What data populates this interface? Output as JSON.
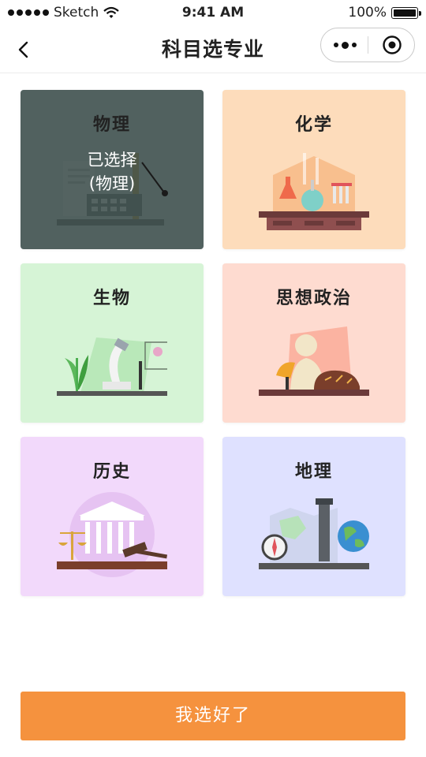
{
  "status_bar": {
    "carrier": "Sketch",
    "time": "9:41 AM",
    "battery": "100%"
  },
  "nav": {
    "title": "科目选专业"
  },
  "subjects": [
    {
      "label": "物理",
      "selected": true,
      "selected_text": "已选择",
      "selected_sub": "(物理)",
      "color": "#dfe7e6"
    },
    {
      "label": "化学",
      "selected": false,
      "color": "#fddcbb"
    },
    {
      "label": "生物",
      "selected": false,
      "color": "#d6f4d6"
    },
    {
      "label": "思想政治",
      "selected": false,
      "color": "#fedbd0"
    },
    {
      "label": "历史",
      "selected": false,
      "color": "#f2d9fb"
    },
    {
      "label": "地理",
      "selected": false,
      "color": "#dfe1ff"
    }
  ],
  "confirm_button": {
    "label": "我选好了",
    "color": "#f5923e"
  },
  "icons": [
    "wifi-icon",
    "battery-icon",
    "back-chevron-icon",
    "more-dots-icon",
    "target-circle-icon"
  ]
}
